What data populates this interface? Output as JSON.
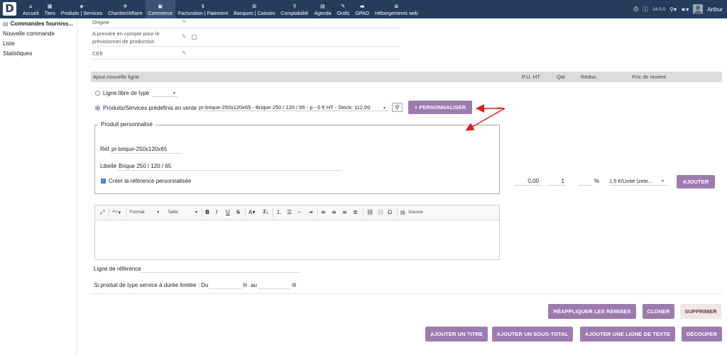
{
  "app": {
    "logo_letter": "D",
    "version": "14.0.0",
    "user": "Arthur"
  },
  "menu": [
    {
      "label": "Accueil",
      "icon": "⌂",
      "name": "menu-accueil",
      "active": false
    },
    {
      "label": "Tiers",
      "icon": "▦",
      "name": "menu-tiers",
      "active": false
    },
    {
      "label": "Produits | Services",
      "icon": "◈",
      "name": "menu-produits-services",
      "active": false
    },
    {
      "label": "Chantier/Affaire",
      "icon": "✣",
      "name": "menu-chantier-affaire",
      "active": false
    },
    {
      "label": "Commerce",
      "icon": "▣",
      "name": "menu-commerce",
      "active": true
    },
    {
      "label": "Facturation | Paiement",
      "icon": "$",
      "name": "menu-facturation-paiement",
      "active": false
    },
    {
      "label": "Banques | Caisses",
      "icon": "⊞",
      "name": "menu-banques-caisses",
      "active": false
    },
    {
      "label": "Comptabilité",
      "icon": "⚲",
      "name": "menu-comptabilite",
      "active": false
    },
    {
      "label": "Agenda",
      "icon": "▤",
      "name": "menu-agenda",
      "active": false
    },
    {
      "label": "Outils",
      "icon": "✎",
      "name": "menu-outils",
      "active": false
    },
    {
      "label": "GPAO",
      "icon": "▬",
      "name": "menu-gpao",
      "active": false
    },
    {
      "label": "Hébergements web",
      "icon": "≣",
      "name": "menu-hebergements-web",
      "active": false
    }
  ],
  "sidebar": {
    "title": "Commandes fourniss...",
    "items": [
      "Nouvelle commande",
      "Liste",
      "Statistiques"
    ]
  },
  "fields": {
    "origine": "Origine",
    "previsionnel": "A prendre en compte pour le prévisionnel de production",
    "cee": "CEE"
  },
  "addline": {
    "header": "Ajout nouvelle ligne",
    "col_pu": "P.U. HT",
    "col_qte": "Qté",
    "col_reduc": "Réduc.",
    "col_prix_revient": "Prix de revient",
    "free_line_label": "Ligne libre de type",
    "predefined_label": "Produits/Services prédéfinis en vente",
    "predefined_value": "pr-brique-250x120x65 - Brique 250 / 120 / 65 - p - 0 € HT - Stock: 112,00",
    "personalize_button": "+ PERSONNALISER"
  },
  "custom_product": {
    "legend": "Produit personnalisé",
    "ref_label": "Réf.",
    "ref_value": "pr-brique-250x120x65",
    "label_label": "Libellé",
    "label_value": "Brique 250 / 120 / 65",
    "create_ref_label": "Créer la référence personnalisée"
  },
  "line_values": {
    "pu_ht": "0,00",
    "qte": "1",
    "reduc_unit": "%",
    "prix_revient": "1,5 €/Unité (zete...",
    "add_button": "AJOUTER"
  },
  "editor": {
    "format_label": "Format",
    "size_label": "Taille",
    "source_label": "Source"
  },
  "bottom": {
    "ref_line_label": "Ligne de référence",
    "service_label": "Si produit de type service à durée limitée : Du",
    "au_label": "au"
  },
  "actions": {
    "reapply_discounts": "RÉAPPLIQUER LES REMISES",
    "clone": "CLONER",
    "delete": "SUPPRIMER",
    "add_title": "AJOUTER UN TITRE",
    "add_subtotal": "AJOUTER UN SOUS-TOTAL",
    "add_text_line": "AJOUTER UNE LIGNE DE TEXTE",
    "split": "DÉCOUPER"
  },
  "colors": {
    "topbar": "#263c5c",
    "button_primary": "#9d7ab0",
    "button_danger_bg": "#ede7e7",
    "annotation_arrow": "#d8201c"
  }
}
